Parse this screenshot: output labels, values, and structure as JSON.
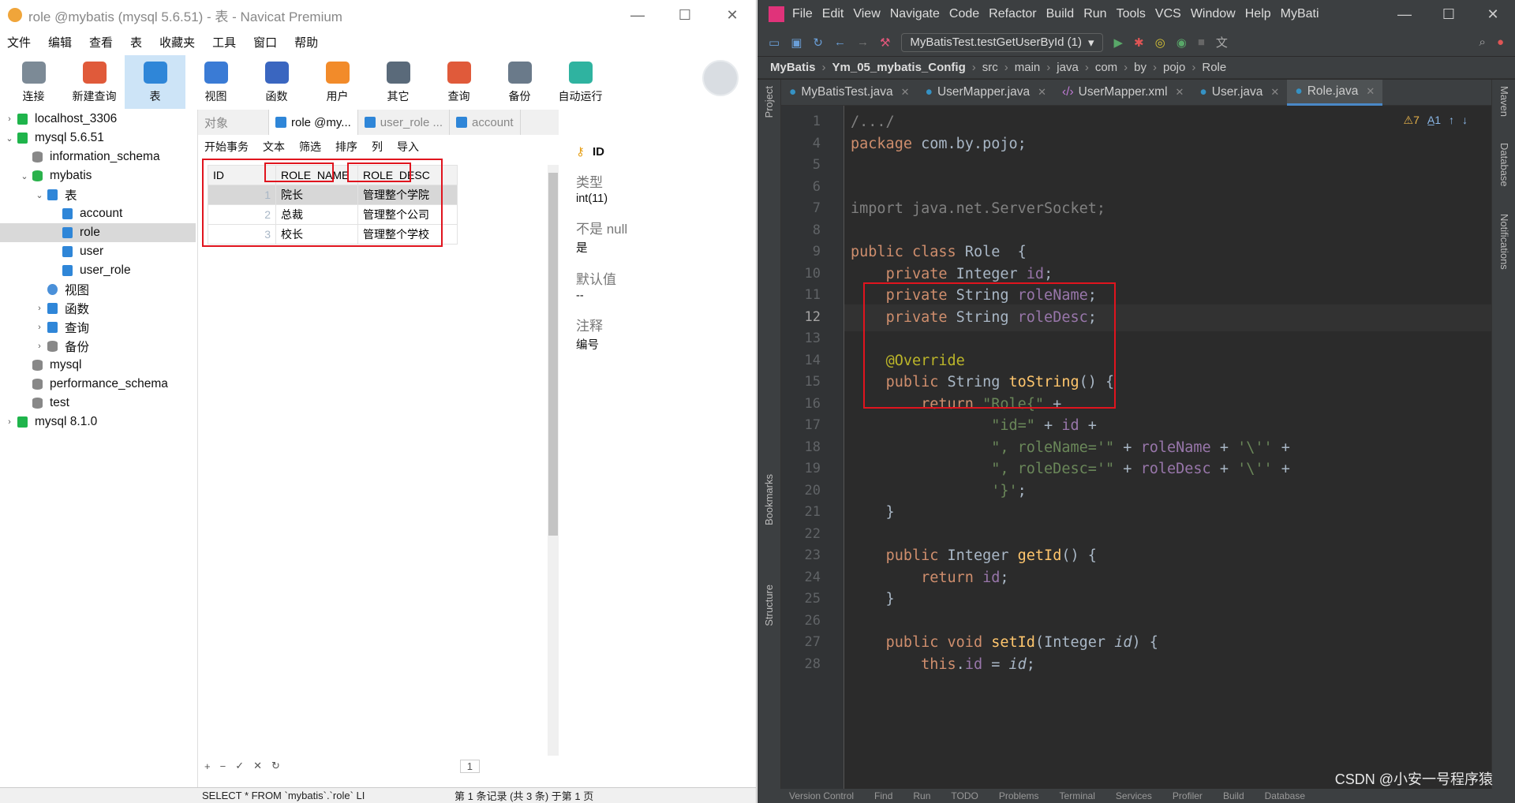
{
  "navicat": {
    "title": "role @mybatis (mysql 5.6.51) - 表 - Navicat Premium",
    "menu": [
      "文件",
      "编辑",
      "查看",
      "表",
      "收藏夹",
      "工具",
      "窗口",
      "帮助"
    ],
    "toolbar": [
      "连接",
      "新建查询",
      "表",
      "视图",
      "函数",
      "用户",
      "其它",
      "查询",
      "备份",
      "自动运行"
    ],
    "toolbar_colors": [
      "#7c8a96",
      "#e05a3a",
      "#2f86d8",
      "#3a7bd5",
      "#3a66c0",
      "#f28b2a",
      "#5a6a7a",
      "#e05a3a",
      "#6a7a8a",
      "#2fb3a0"
    ],
    "tree": [
      {
        "label": "localhost_3306",
        "icon": "conn",
        "level": 0,
        "arrow": "›"
      },
      {
        "label": "mysql 5.6.51",
        "icon": "conn",
        "level": 0,
        "arrow": "⌄"
      },
      {
        "label": "information_schema",
        "icon": "db-grey",
        "level": 1,
        "arrow": ""
      },
      {
        "label": "mybatis",
        "icon": "db-green",
        "level": 1,
        "arrow": "⌄"
      },
      {
        "label": "表",
        "icon": "tbl",
        "level": 2,
        "arrow": "⌄"
      },
      {
        "label": "account",
        "icon": "tbl",
        "level": 3,
        "arrow": ""
      },
      {
        "label": "role",
        "icon": "tbl",
        "level": 3,
        "arrow": "",
        "selected": true
      },
      {
        "label": "user",
        "icon": "tbl",
        "level": 3,
        "arrow": ""
      },
      {
        "label": "user_role",
        "icon": "tbl",
        "level": 3,
        "arrow": ""
      },
      {
        "label": "视图",
        "icon": "vw",
        "level": 2,
        "arrow": ""
      },
      {
        "label": "函数",
        "icon": "tbl",
        "level": 2,
        "arrow": "›"
      },
      {
        "label": "查询",
        "icon": "tbl",
        "level": 2,
        "arrow": "›"
      },
      {
        "label": "备份",
        "icon": "db-grey",
        "level": 2,
        "arrow": "›"
      },
      {
        "label": "mysql",
        "icon": "db-grey",
        "level": 1,
        "arrow": ""
      },
      {
        "label": "performance_schema",
        "icon": "db-grey",
        "level": 1,
        "arrow": ""
      },
      {
        "label": "test",
        "icon": "db-grey",
        "level": 1,
        "arrow": ""
      },
      {
        "label": "mysql 8.1.0",
        "icon": "conn",
        "level": 0,
        "arrow": "›"
      }
    ],
    "tabs": [
      "对象",
      "role @my...",
      "user_role ...",
      "account"
    ],
    "grid_toolbar": [
      "开始事务",
      "文本",
      "筛选",
      "排序",
      "列",
      "导入"
    ],
    "columns": [
      "ID",
      "ROLE_NAME",
      "ROLE_DESC"
    ],
    "rows": [
      [
        "1",
        "院长",
        "管理整个学院"
      ],
      [
        "2",
        "总裁",
        "管理整个公司"
      ],
      [
        "3",
        "校长",
        "管理整个学校"
      ]
    ],
    "page": "1",
    "props": {
      "field": "ID",
      "type_label": "类型",
      "type_value": "int(11)",
      "notnull_label": "不是 null",
      "notnull_value": "是",
      "default_label": "默认值",
      "default_value": "--",
      "comment_label": "注释",
      "comment_value": "编号"
    },
    "status_sql": "SELECT * FROM `mybatis`.`role` LI",
    "status_records": "第 1 条记录 (共 3 条) 于第 1 页"
  },
  "idea": {
    "menu": [
      "File",
      "Edit",
      "View",
      "Navigate",
      "Code",
      "Refactor",
      "Build",
      "Run",
      "Tools",
      "VCS",
      "Window",
      "Help",
      "MyBati"
    ],
    "run_config": "MyBatisTest.testGetUserById (1)",
    "crumbs": [
      "MyBatis",
      "Ym_05_mybatis_Config",
      "src",
      "main",
      "java",
      "com",
      "by",
      "pojo",
      "Role"
    ],
    "tabs": [
      "MyBatisTest.java",
      "UserMapper.java",
      "UserMapper.xml",
      "User.java",
      "Role.java"
    ],
    "active_tab": 4,
    "inspection": {
      "warnings": "⚠7",
      "typos": "A̲1"
    },
    "left_labels": [
      "Project",
      "Bookmarks",
      "Structure"
    ],
    "right_labels": [
      "Maven",
      "Database",
      "Notifications"
    ],
    "status_items": [
      "Version Control",
      "Find",
      "Run",
      "TODO",
      "Problems",
      "Terminal",
      "Services",
      "Profiler",
      "Build",
      "Database"
    ],
    "watermark": "CSDN @小安一号程序猿",
    "lines": [
      {
        "n": "1",
        "html": "<span class='c'>/.../</span>"
      },
      {
        "n": "4",
        "html": "<span class='pl'>package</span> <span class='ty'>com.by.pojo</span>;"
      },
      {
        "n": "5",
        "html": ""
      },
      {
        "n": "6",
        "html": ""
      },
      {
        "n": "7",
        "html": "<span class='c'>import java.net.ServerSocket;</span>"
      },
      {
        "n": "8",
        "html": ""
      },
      {
        "n": "9",
        "html": "<span class='pl'>public</span> <span class='pl'>class</span> <span class='ty'>Role</span>  {"
      },
      {
        "n": "10",
        "html": "    <span class='pl'>private</span> <span class='ty'>Integer</span> <span class='fd'>id</span>;"
      },
      {
        "n": "11",
        "html": "    <span class='pl'>private</span> <span class='ty'>String</span> <span class='fd'>roleName</span>;"
      },
      {
        "n": "12",
        "html": "    <span class='pl'>private</span> <span class='ty'>String</span> <span class='fd'>roleDesc</span>;",
        "cur": true
      },
      {
        "n": "13",
        "html": ""
      },
      {
        "n": "14",
        "html": "    <span class='an'>@Override</span>"
      },
      {
        "n": "15",
        "html": "    <span class='pl'>public</span> <span class='ty'>String</span> <span class='fn'>toString</span>() {"
      },
      {
        "n": "16",
        "html": "        <span class='pl'>return</span> <span class='s'>\"Role{\"</span> +"
      },
      {
        "n": "17",
        "html": "                <span class='s'>\"id=\"</span> + <span class='fd'>id</span> +"
      },
      {
        "n": "18",
        "html": "                <span class='s'>\", roleName='\"</span> + <span class='fd'>roleName</span> + <span class='s'>'\\''</span> +"
      },
      {
        "n": "19",
        "html": "                <span class='s'>\", roleDesc='\"</span> + <span class='fd'>roleDesc</span> + <span class='s'>'\\''</span> +"
      },
      {
        "n": "20",
        "html": "                <span class='s'>'}'</span>;"
      },
      {
        "n": "21",
        "html": "    }"
      },
      {
        "n": "22",
        "html": ""
      },
      {
        "n": "23",
        "html": "    <span class='pl'>public</span> <span class='ty'>Integer</span> <span class='fn'>getId</span>() {"
      },
      {
        "n": "24",
        "html": "        <span class='pl'>return</span> <span class='fd'>id</span>;"
      },
      {
        "n": "25",
        "html": "    }"
      },
      {
        "n": "26",
        "html": ""
      },
      {
        "n": "27",
        "html": "    <span class='pl'>public</span> <span class='pl'>void</span> <span class='fn'>setId</span>(<span class='ty'>Integer</span> <i>id</i>) {"
      },
      {
        "n": "28",
        "html": "        <span class='pl'>this</span>.<span class='fd'>id</span> = <i>id</i>;"
      }
    ]
  }
}
